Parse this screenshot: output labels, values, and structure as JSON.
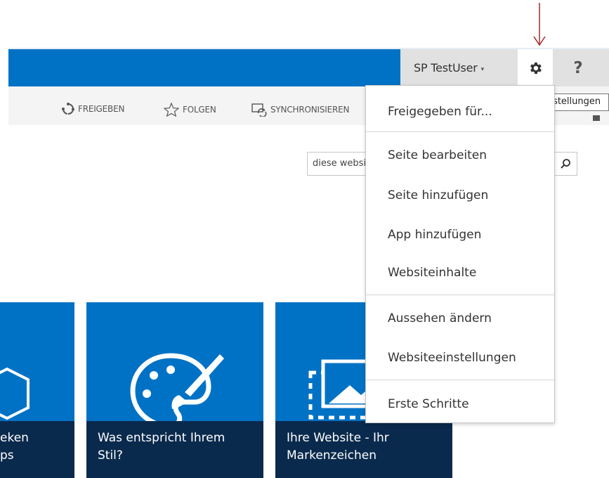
{
  "topbar": {
    "user_name": "SP TestUser",
    "user_caret": "▾",
    "settings_icon": "gear-icon",
    "help_label": "?"
  },
  "actions": [
    {
      "label": "FREIGEBEN",
      "icon": "share-icon"
    },
    {
      "label": "FOLGEN",
      "icon": "star-icon"
    },
    {
      "label": "SYNCHRONISIEREN",
      "icon": "sync-icon"
    }
  ],
  "tooltip": "Einstellungen",
  "search": {
    "placeholder": "diese website durchsuchen",
    "icon": "search-icon"
  },
  "settings_menu": {
    "groups": [
      [
        "Freigegeben für..."
      ],
      [
        "Seite bearbeiten",
        "Seite hinzufügen",
        "App hinzufügen",
        "Websiteinhalte"
      ],
      [
        "Aussehen ändern",
        "Websiteeinstellungen"
      ],
      [
        "Erste Schritte"
      ]
    ]
  },
  "tiles": [
    {
      "line1": "eken",
      "line2": "ps",
      "icon": "apps-icon"
    },
    {
      "line1": "Was entspricht Ihrem",
      "line2": "Stil?",
      "icon": "palette-icon"
    },
    {
      "line1": "Ihre Website - Ihr",
      "line2": "Markenzeichen",
      "icon": "picture-icon"
    }
  ],
  "colors": {
    "suite_bar": "#0072c6",
    "tile_bg": "#0072c6",
    "tile_caption_bg": "#0a2a4d",
    "annotation_arrow": "#a12b2b"
  }
}
